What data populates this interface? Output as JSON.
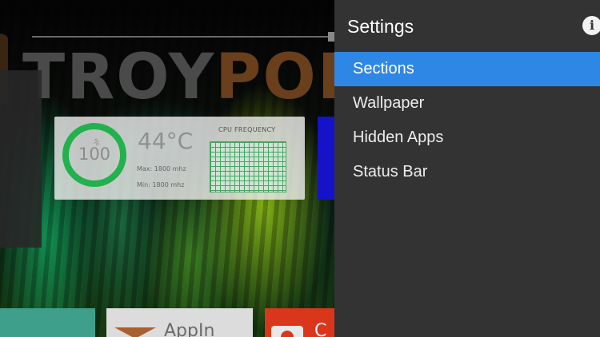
{
  "background": {
    "brand": {
      "part1": "TROY",
      "part2": "POI"
    },
    "cpu_widget": {
      "gauge_value": "100",
      "gauge_tick": "%",
      "temperature": "44°C",
      "max_freq": "Max:  1800 mhz",
      "min_freq": "Min:   1800 mhz",
      "cpu_label": "CPU FREQUENCY"
    },
    "tiles": {
      "appin_label": "AppIn",
      "red_label": "C"
    }
  },
  "settings": {
    "title": "Settings",
    "info_icon": "i",
    "items": [
      {
        "label": "Sections",
        "selected": true
      },
      {
        "label": "Wallpaper",
        "selected": false
      },
      {
        "label": "Hidden Apps",
        "selected": false
      },
      {
        "label": "Status Bar",
        "selected": false
      }
    ]
  },
  "colors": {
    "drawer_bg": "#333333",
    "selected_bg": "#2f87e5",
    "gauge_green": "#22b14c"
  }
}
